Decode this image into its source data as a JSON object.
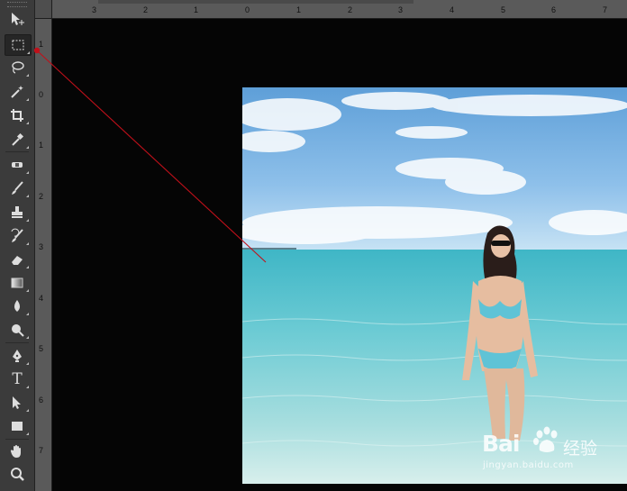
{
  "tools": [
    {
      "name": "move-tool",
      "icon": "move-icon",
      "active": false
    },
    {
      "name": "rectangular-marquee-tool",
      "icon": "marquee-icon",
      "active": true
    },
    {
      "name": "lasso-tool",
      "icon": "lasso-icon",
      "active": false
    },
    {
      "name": "magic-wand-tool",
      "icon": "magic-wand-icon",
      "active": false
    },
    {
      "name": "crop-tool",
      "icon": "crop-icon",
      "active": false
    },
    {
      "name": "eyedropper-tool",
      "icon": "eyedropper-icon",
      "active": false
    },
    {
      "name": "healing-brush-tool",
      "icon": "bandage-icon",
      "active": false
    },
    {
      "name": "brush-tool",
      "icon": "brush-icon",
      "active": false
    },
    {
      "name": "clone-stamp-tool",
      "icon": "stamp-icon",
      "active": false
    },
    {
      "name": "history-brush-tool",
      "icon": "history-brush-icon",
      "active": false
    },
    {
      "name": "eraser-tool",
      "icon": "eraser-icon",
      "active": false
    },
    {
      "name": "gradient-tool",
      "icon": "gradient-icon",
      "active": false
    },
    {
      "name": "blur-tool",
      "icon": "blur-icon",
      "active": false
    },
    {
      "name": "dodge-tool",
      "icon": "dodge-icon",
      "active": false
    },
    {
      "name": "pen-tool",
      "icon": "pen-icon",
      "active": false
    },
    {
      "name": "type-tool",
      "icon": "type-icon",
      "label": "T",
      "active": false
    },
    {
      "name": "path-selection-tool",
      "icon": "path-select-icon",
      "active": false
    },
    {
      "name": "rectangle-tool",
      "icon": "rectangle-icon",
      "active": false
    },
    {
      "name": "hand-tool",
      "icon": "hand-icon",
      "active": false
    },
    {
      "name": "zoom-tool",
      "icon": "zoom-icon",
      "active": false
    }
  ],
  "ruler_top_labels": [
    "3",
    "2",
    "1",
    "0",
    "1",
    "2",
    "3",
    "4",
    "5",
    "6",
    "7"
  ],
  "ruler_left_labels": [
    "1",
    "0",
    "1",
    "2",
    "3",
    "4",
    "5",
    "6",
    "7"
  ],
  "watermark": {
    "logo": "Bai",
    "logo_suffix": "经验",
    "url": "jingyan.baidu.com"
  },
  "colors": {
    "panel": "#3b3b3b",
    "ruler": "#5a5a5a",
    "canvas": "#050505",
    "annotation_arrow": "#c0101a"
  }
}
